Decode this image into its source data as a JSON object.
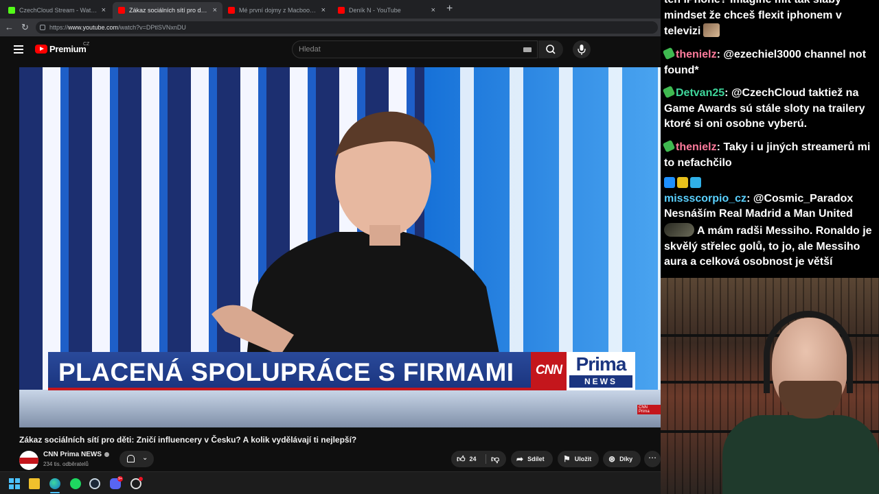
{
  "browser": {
    "tabs": [
      {
        "title": "CzechCloud Stream - Watch Live o",
        "icon_color": "#53fc18",
        "active": false
      },
      {
        "title": "Zákaz sociálních sítí pro děti: Z",
        "icon_color": "#ff0000",
        "active": true
      },
      {
        "title": "Mé první dojmy z Macbook Neo.",
        "icon_color": "#ff0000",
        "active": false
      },
      {
        "title": "Deník N - YouTube",
        "icon_color": "#ff0000",
        "active": false
      }
    ],
    "close_glyph": "×",
    "new_tab_glyph": "+",
    "url_scheme": "https://",
    "url_host": "www.youtube.com",
    "url_path": "/watch?v=DPtlSVNxnDU"
  },
  "youtube": {
    "brand": "Premium",
    "country": "CZ",
    "search_placeholder": "Hledat",
    "video_title": "Zákaz sociálních sítí pro děti: Zničí influencery v Česku? A kolik vydělávají ti nejlepší?",
    "channel_name": "CNN Prima NEWS",
    "subscribers": "234 tis. odběratelů",
    "like_count": "24",
    "share_label": "Sdílet",
    "save_label": "Uložit",
    "thanks_label": "Díky"
  },
  "video": {
    "banner_text": "PLACENÁ SPOLUPRÁCE S FIRMAMI",
    "logo_cnn": "CNN",
    "logo_prima": "Prima",
    "logo_news": "NEWS",
    "watermark": "CNN Prima"
  },
  "chat": {
    "messages": [
      {
        "user": "",
        "text": "ten iPhone? Imagine mít tak slabý mindset že chceš flexit iphonem v televizi",
        "user_color": "#ffffff"
      },
      {
        "user": "thenielz",
        "text": "@ezechiel3000 channel not found*",
        "user_color": "#ff7b9c"
      },
      {
        "user": "Detvan25",
        "text": "@CzechCloud taktiež na Game Awards sú stále sloty na trailery ktoré si oni osobne vyberú.",
        "user_color": "#3fd69b"
      },
      {
        "user": "thenielz",
        "text": "Taky i u jiných streamerů mi to nefachčilo",
        "user_color": "#ff7b9c"
      },
      {
        "user": "missscorpio_cz",
        "text": "@Cosmic_Paradox Nesnáším Real Madrid a Man United",
        "user_color": "#5ad1ff"
      },
      {
        "user": "",
        "text": "A mám radši Messiho. Ronaldo je skvělý střelec golů, to jo, ale Messiho aura a celková osobnost je větší",
        "user_color": "#ffffff"
      }
    ]
  },
  "taskbar": {
    "discord_badge": "9+"
  }
}
